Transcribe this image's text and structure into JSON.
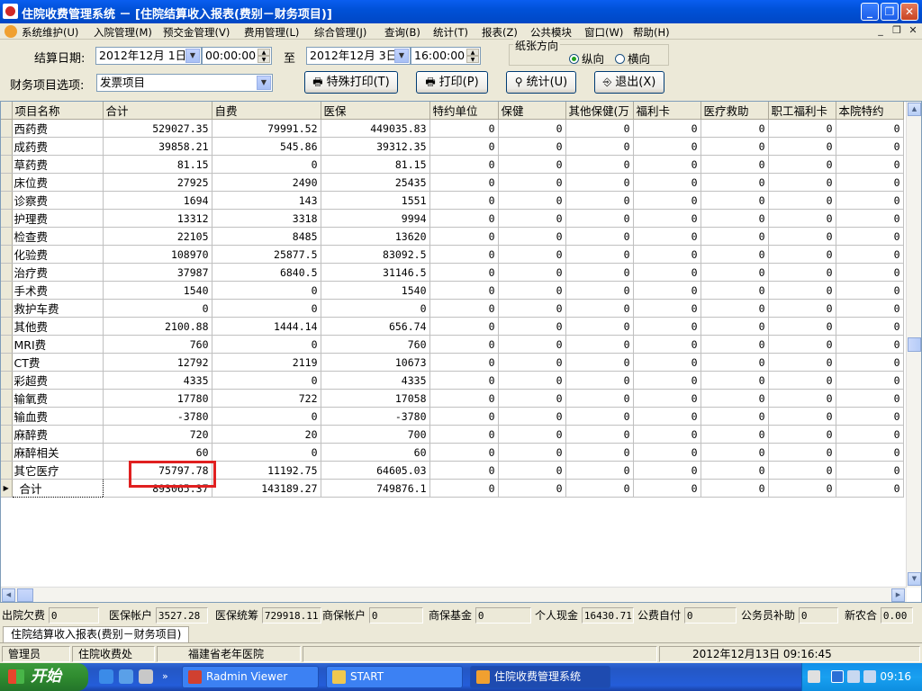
{
  "window": {
    "title": "住院收费管理系统 － [住院结算收入报表(费别－财务项目)]",
    "min": "_",
    "restore": "❐",
    "close": "✕"
  },
  "menu": {
    "items": [
      "系统维护(U)",
      "入院管理(M)",
      "预交金管理(V)",
      "费用管理(L)",
      "综合管理(J)",
      "查询(B)",
      "统计(T)",
      "报表(Z)",
      "公共模块",
      "窗口(W)",
      "帮助(H)"
    ],
    "mdi_min": "_",
    "mdi_restore": "❐",
    "mdi_close": "✕"
  },
  "toolbar": {
    "date_label": "结算日期:",
    "start_date": "2012年12月 1日",
    "start_time": "00:00:00",
    "to_label": "至",
    "end_date": "2012年12月 3日",
    "end_time": "16:00:00",
    "orientation_title": "纸张方向",
    "portrait": "纵向",
    "landscape": "横向",
    "orientation_selected": "纵向",
    "finance_label": "财务项目选项:",
    "finance_value": "发票项目",
    "special_print": "特殊打印(T)",
    "print": "打印(P)",
    "stats": "统计(U)",
    "exit": "退出(X)"
  },
  "grid": {
    "columns": [
      "项目名称",
      "合计",
      "自费",
      "医保",
      "特约单位",
      "保健",
      "其他保健(万",
      "福利卡",
      "医疗救助",
      "职工福利卡",
      "本院特约"
    ],
    "rows": [
      [
        "西药费",
        "529027.35",
        "79991.52",
        "449035.83",
        "0",
        "0",
        "0",
        "0",
        "0",
        "0",
        "0"
      ],
      [
        "成药费",
        "39858.21",
        "545.86",
        "39312.35",
        "0",
        "0",
        "0",
        "0",
        "0",
        "0",
        "0"
      ],
      [
        "草药费",
        "81.15",
        "0",
        "81.15",
        "0",
        "0",
        "0",
        "0",
        "0",
        "0",
        "0"
      ],
      [
        "床位费",
        "27925",
        "2490",
        "25435",
        "0",
        "0",
        "0",
        "0",
        "0",
        "0",
        "0"
      ],
      [
        "诊察费",
        "1694",
        "143",
        "1551",
        "0",
        "0",
        "0",
        "0",
        "0",
        "0",
        "0"
      ],
      [
        "护理费",
        "13312",
        "3318",
        "9994",
        "0",
        "0",
        "0",
        "0",
        "0",
        "0",
        "0"
      ],
      [
        "检查费",
        "22105",
        "8485",
        "13620",
        "0",
        "0",
        "0",
        "0",
        "0",
        "0",
        "0"
      ],
      [
        "化验费",
        "108970",
        "25877.5",
        "83092.5",
        "0",
        "0",
        "0",
        "0",
        "0",
        "0",
        "0"
      ],
      [
        "治疗费",
        "37987",
        "6840.5",
        "31146.5",
        "0",
        "0",
        "0",
        "0",
        "0",
        "0",
        "0"
      ],
      [
        "手术费",
        "1540",
        "0",
        "1540",
        "0",
        "0",
        "0",
        "0",
        "0",
        "0",
        "0"
      ],
      [
        "救护车费",
        "0",
        "0",
        "0",
        "0",
        "0",
        "0",
        "0",
        "0",
        "0",
        "0"
      ],
      [
        "其他费",
        "2100.88",
        "1444.14",
        "656.74",
        "0",
        "0",
        "0",
        "0",
        "0",
        "0",
        "0"
      ],
      [
        "MRI费",
        "760",
        "0",
        "760",
        "0",
        "0",
        "0",
        "0",
        "0",
        "0",
        "0"
      ],
      [
        "CT费",
        "12792",
        "2119",
        "10673",
        "0",
        "0",
        "0",
        "0",
        "0",
        "0",
        "0"
      ],
      [
        "彩超费",
        "4335",
        "0",
        "4335",
        "0",
        "0",
        "0",
        "0",
        "0",
        "0",
        "0"
      ],
      [
        "输氧费",
        "17780",
        "722",
        "17058",
        "0",
        "0",
        "0",
        "0",
        "0",
        "0",
        "0"
      ],
      [
        "输血费",
        "-3780",
        "0",
        "-3780",
        "0",
        "0",
        "0",
        "0",
        "0",
        "0",
        "0"
      ],
      [
        "麻醉费",
        "720",
        "20",
        "700",
        "0",
        "0",
        "0",
        "0",
        "0",
        "0",
        "0"
      ],
      [
        "麻醉相关",
        "60",
        "0",
        "60",
        "0",
        "0",
        "0",
        "0",
        "0",
        "0",
        "0"
      ],
      [
        "其它医疗",
        "75797.78",
        "11192.75",
        "64605.03",
        "0",
        "0",
        "0",
        "0",
        "0",
        "0",
        "0"
      ],
      [
        "合计",
        "893065.37",
        "143189.27",
        "749876.1",
        "0",
        "0",
        "0",
        "0",
        "0",
        "0",
        "0"
      ]
    ]
  },
  "summary": [
    {
      "label": "出院欠费",
      "value": "0"
    },
    {
      "label": "医保帐户",
      "value": "3527.28"
    },
    {
      "label": "医保统筹",
      "value": "729918.11"
    },
    {
      "label": "商保帐户",
      "value": "0"
    },
    {
      "label": "商保基金",
      "value": "0"
    },
    {
      "label": "个人现金",
      "value": "16430.71"
    },
    {
      "label": "公费自付",
      "value": "0"
    },
    {
      "label": "公务员补助",
      "value": "0"
    },
    {
      "label": "新农合",
      "value": "0.00"
    }
  ],
  "tab": "住院结算收入报表(费别－财务项目)",
  "status": {
    "user": "管理员",
    "dept": "住院收费处",
    "hospital": "福建省老年医院",
    "datetime": "2012年12月13日 09:16:45"
  },
  "taskbar": {
    "start": "开始",
    "tasks": [
      "Radmin Viewer",
      "START",
      "住院收费管理系统"
    ],
    "clock": "09:16"
  },
  "colors": {
    "highlight_box": "#e02020",
    "title_blue": "#0051d8",
    "taskbar_blue": "#245dd9"
  }
}
